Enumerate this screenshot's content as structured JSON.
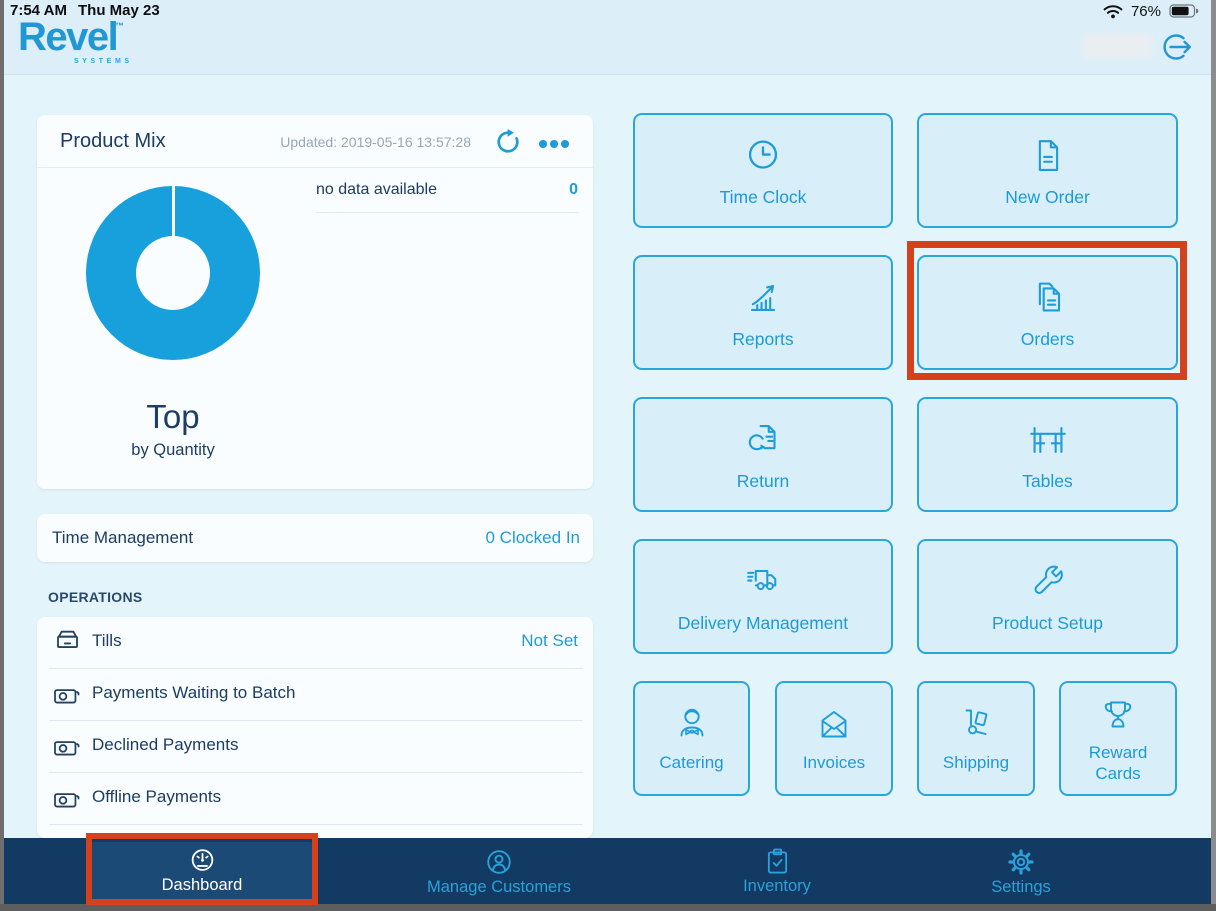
{
  "status_bar": {
    "time": "7:54 AM",
    "date": "Thu May 23",
    "battery_percent": "76%"
  },
  "header": {
    "brand": "Revel",
    "brand_tm": "™",
    "brand_sub": "SYSTEMS"
  },
  "product_mix": {
    "title": "Product Mix",
    "updated": "Updated: 2019-05-16 13:57:28",
    "legend_label": "no data available",
    "legend_value": "0",
    "center_title": "Top",
    "center_subtitle": "by Quantity"
  },
  "time_management": {
    "label": "Time Management",
    "value": "0 Clocked In"
  },
  "operations": {
    "heading": "OPERATIONS",
    "rows": [
      {
        "label": "Tills",
        "value": "Not Set"
      },
      {
        "label": "Payments Waiting to Batch",
        "value": ""
      },
      {
        "label": "Declined Payments",
        "value": ""
      },
      {
        "label": "Offline Payments",
        "value": ""
      }
    ]
  },
  "tiles": [
    {
      "label": "Time Clock"
    },
    {
      "label": "New Order"
    },
    {
      "label": "Reports"
    },
    {
      "label": "Orders",
      "annotated": true
    },
    {
      "label": "Return"
    },
    {
      "label": "Tables"
    },
    {
      "label": "Delivery Management"
    },
    {
      "label": "Product Setup"
    },
    {
      "label": "Catering"
    },
    {
      "label": "Invoices"
    },
    {
      "label": "Shipping"
    },
    {
      "label": "Reward Cards"
    }
  ],
  "bottom_nav": {
    "items": [
      {
        "label": "Dashboard",
        "active": true,
        "annotated": true
      },
      {
        "label": "Manage Customers"
      },
      {
        "label": "Inventory"
      },
      {
        "label": "Settings"
      }
    ]
  },
  "chart_data": {
    "type": "pie",
    "title": "Top by Quantity",
    "categories": [
      "no data available"
    ],
    "values": [
      0
    ],
    "legend_position": "right",
    "color": "#18a0dc"
  },
  "colors": {
    "accent_blue": "#1e9cd8",
    "navy_text": "#1d3c60",
    "nav_bg": "#123a62",
    "nav_active_bg": "#1b4a77",
    "annotation_red": "#d5401d",
    "tile_bg": "#d8eff9",
    "tile_border": "#2ba6db",
    "page_bg": "#e4f4fb",
    "header_bg": "#dceef8",
    "card_bg": "#f9fdff",
    "donut_blue": "#18a0dc",
    "muted_gray": "#97a7b4"
  }
}
